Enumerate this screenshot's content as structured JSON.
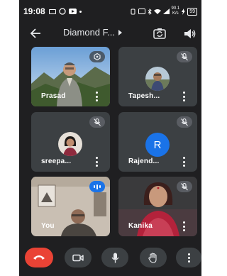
{
  "status_bar": {
    "time": "19:08",
    "network_speed_value": "90.1",
    "network_speed_unit": "K/s",
    "battery": "59"
  },
  "app_bar": {
    "title": "Diamond F..."
  },
  "participants": [
    {
      "name": "Prasad",
      "state": "video",
      "badge": "pin"
    },
    {
      "name": "Tapesh...",
      "state": "avatar-photo",
      "badge": "muted"
    },
    {
      "name": "sreepa...",
      "state": "avatar-photo",
      "badge": "muted"
    },
    {
      "name": "Rajend...",
      "state": "avatar-letter",
      "avatar_letter": "R",
      "badge": "muted"
    },
    {
      "name": "You",
      "state": "video",
      "badge": "speaking"
    },
    {
      "name": "Kanika",
      "state": "video",
      "badge": "muted"
    }
  ],
  "icons": {
    "back": "arrow-left-icon",
    "switch_camera": "switch-camera-icon",
    "speaker": "speaker-icon",
    "mute": "mic-off-icon",
    "more": "more-vert-icon",
    "end_call": "call-end-icon",
    "camera": "videocam-icon",
    "mic": "mic-icon",
    "hand": "raise-hand-icon"
  },
  "colors": {
    "background": "#1f1f21",
    "tile": "#3c4043",
    "end_call": "#ea4335",
    "avatar_blue": "#1a73e8",
    "speaking": "#1a73e8"
  }
}
